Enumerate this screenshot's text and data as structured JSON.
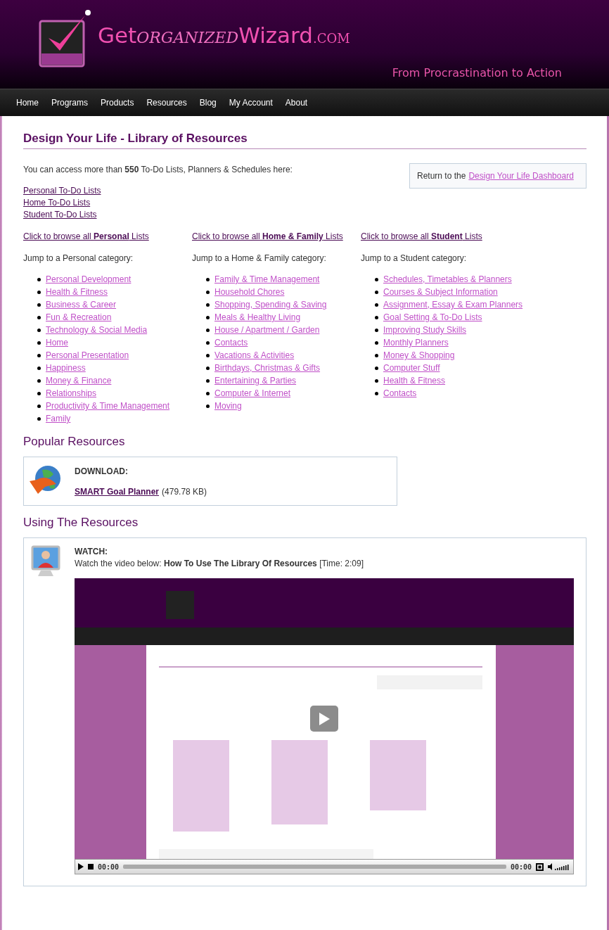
{
  "header": {
    "logo": [
      "Get",
      "ORGANIZED",
      "Wizard",
      ".COM"
    ],
    "tagline": "From Procrastination to Action"
  },
  "nav": [
    "Home",
    "Programs",
    "Products",
    "Resources",
    "Blog",
    "My Account",
    "About"
  ],
  "title": "Design Your Life - Library of Resources",
  "intro": "You can access more than **550** To-Do Lists, Planners & Schedules here:",
  "return_box": {
    "text": "Return to the",
    "link": "Design Your Life Dashboard"
  },
  "quick_links": [
    "Personal To-Do Lists",
    "Home To-Do Lists",
    "Student To-Do Lists"
  ],
  "columns": [
    {
      "browse_link": "Click to browse all **Personal** Lists",
      "jump_label": "Jump to a Personal category:",
      "categories": [
        "Personal Development",
        "Health & Fitness",
        "Business & Career",
        "Fun & Recreation",
        "Technology & Social Media",
        "Home",
        "Personal Presentation",
        "Happiness",
        "Money & Finance",
        "Relationships",
        "Productivity & Time Management",
        "Family"
      ]
    },
    {
      "browse_link": "Click to browse all **Home & Family** Lists",
      "jump_label": "Jump to a Home & Family category:",
      "categories": [
        "Family & Time Management",
        "Household Chores",
        "Shopping, Spending & Saving",
        "Meals & Healthy Living",
        "House / Apartment / Garden",
        "Contacts",
        "Vacations & Activities",
        "Birthdays, Christmas & Gifts",
        "Entertaining & Parties",
        "Computer & Internet",
        "Moving"
      ]
    },
    {
      "browse_link": "Click to browse all **Student** Lists",
      "jump_label": "Jump to a Student category:",
      "categories": [
        "Schedules, Timetables & Planners",
        "Courses & Subject Information",
        "Assignment, Essay & Exam Planners",
        "Goal Setting & To-Do Lists",
        "Improving Study Skills",
        "Monthly Planners",
        "Money & Shopping",
        "Computer Stuff",
        "Health & Fitness",
        "Contacts"
      ]
    }
  ],
  "popular": {
    "heading": "Popular Resources",
    "label": "DOWNLOAD:",
    "file_link": "SMART Goal Planner",
    "file_size": "(479.78 KB)"
  },
  "using": {
    "heading": "Using The Resources",
    "label": "WATCH:",
    "description": "Watch the video below: **How To Use The Library Of Resources** [Time: 2:09]",
    "video": {
      "kind": "picture",
      "elapsed": "00:00",
      "duration": "00:00"
    }
  }
}
